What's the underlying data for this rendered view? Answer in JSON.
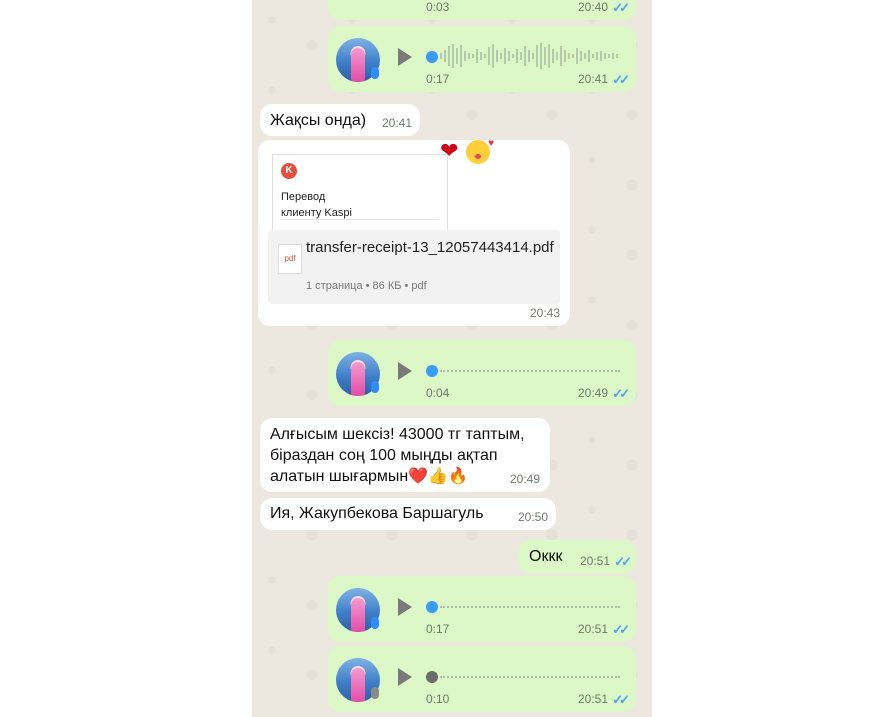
{
  "messages": {
    "voice1": {
      "duration": "0:03",
      "time": "20:40"
    },
    "voice2": {
      "duration": "0:17",
      "time": "20:41"
    },
    "text1": {
      "text": "Жақсы онда)",
      "time": "20:41"
    },
    "doc": {
      "preview_line1": "Перевод",
      "preview_line2": "клиенту Kaspi",
      "pdf_label": "pdf",
      "filename": "transfer-receipt-13_12057443414.pdf",
      "meta": "1 страница • 86 КБ • pdf",
      "time": "20:43"
    },
    "voice3": {
      "duration": "0:04",
      "time": "20:49"
    },
    "text2": {
      "line1": "Алғысым шексіз! 43000 тг таптым,",
      "line2": "біраздан соң 100 мыңды ақтап",
      "line3": "алатын шығармын❤️👍🔥",
      "time": "20:49"
    },
    "text3": {
      "text": "Ия, Жакупбекова Баршагуль",
      "time": "20:50"
    },
    "text4": {
      "text": "Оккк",
      "time": "20:51"
    },
    "voice4": {
      "duration": "0:17",
      "time": "20:51"
    },
    "voice5": {
      "duration": "0:10",
      "time": "20:51"
    }
  },
  "reactions": {
    "heart": "❤",
    "kiss_icon": "kissing-face-icon"
  },
  "ticks": "✓✓",
  "colors": {
    "outgoing": "#dcf8c6",
    "incoming": "#ffffff",
    "tick": "#4fa3f1",
    "bg": "#ece7df"
  }
}
